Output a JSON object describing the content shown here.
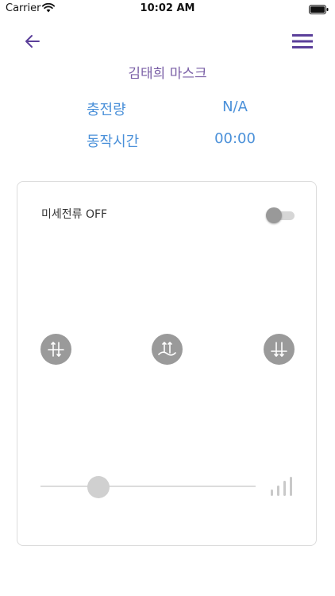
{
  "status_bar": {
    "carrier": "Carrier",
    "time": "10:02 AM"
  },
  "header": {
    "back_icon": "arrow-left-icon",
    "menu_icon": "hamburger-menu-icon",
    "accent_color": "#5b3f9a"
  },
  "device": {
    "name": "김태희 마스크",
    "name_color": "#7a5fa6"
  },
  "info": {
    "charge_label": "충전량",
    "charge_value": "N/A",
    "runtime_label": "동작시간",
    "runtime_value": "00:00",
    "color": "#4a90d9"
  },
  "control": {
    "microcurrent_label": "미세전류 OFF",
    "microcurrent_on": false,
    "modes": [
      {
        "icon": "arrows-converge-icon"
      },
      {
        "icon": "arrows-up-wave-icon"
      },
      {
        "icon": "arrows-down-icon"
      }
    ],
    "intensity_level": 0.27,
    "intensity_icon": "signal-bars-icon"
  }
}
